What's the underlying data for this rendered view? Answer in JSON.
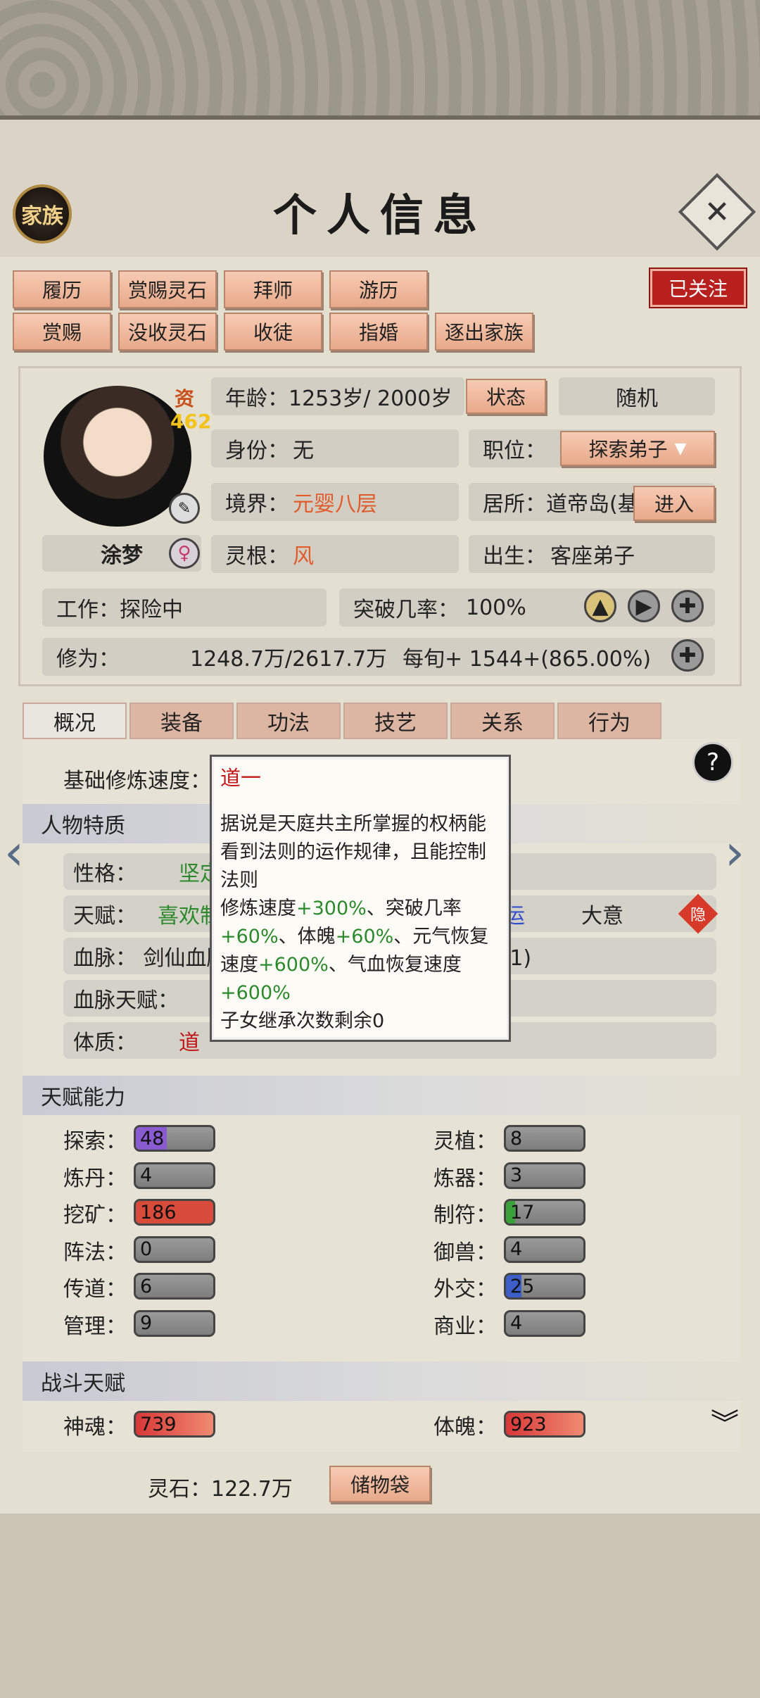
{
  "header": {
    "title": "个人信息",
    "family_label": "家族",
    "close_label": "✕"
  },
  "actions_row1": [
    "履历",
    "赏赐灵石",
    "拜师",
    "游历"
  ],
  "actions_row2": [
    "赏赐",
    "没收灵石",
    "收徒",
    "指婚",
    "逐出家族"
  ],
  "follow_label": "已关注",
  "portrait": {
    "zi_label": "资",
    "zi_value": "462",
    "name": "涂梦",
    "gender_icon": "female-icon"
  },
  "info": {
    "age": "年龄：1253岁/ 2000岁",
    "status_btn": "状态",
    "random_btn": "随机",
    "identity_label": "身份：",
    "identity_value": "无",
    "position_label": "职位：",
    "position_value": "探索弟子",
    "realm_label": "境界：",
    "realm_value": "元婴八层",
    "residence": "居所：道帝岛(基",
    "enter_btn": "进入",
    "root_label": "灵根：",
    "root_value": "风",
    "birth_label": "出生：",
    "birth_value": "客座弟子",
    "work": "工作：探险中",
    "breakthrough_label": "突破几率：",
    "breakthrough_value": "100%",
    "cultivation_label": "修为：",
    "cultivation_value": "1248.7万/2617.7万",
    "per_turn": "每旬+   1544+(865.00%)"
  },
  "tabs": [
    "概况",
    "装备",
    "功法",
    "技艺",
    "关系",
    "行为"
  ],
  "overview": {
    "base_speed_label": "基础修炼速度：",
    "help": "?",
    "traits_title": "人物特质",
    "personality_label": "性格：",
    "personality_value": "坚定",
    "talent_label": "天赋：",
    "talent_value": "喜欢制",
    "talent_value2": "运",
    "talent_value3": "大意",
    "hide_badge": "隐",
    "bloodline": "血脉：  剑仙血脉",
    "bloodline2": "脉(21)",
    "bloodline_talent_label": "血脉天赋：",
    "constitution_label": "体质：",
    "constitution_value": "道"
  },
  "tooltip": {
    "title": "道一",
    "desc": "据说是天庭共主所掌握的权柄能看到法则的运作规律，且能控制法则",
    "l1a": "修炼速度",
    "l1b": "+300%",
    "l1c": "、突破几率",
    "l2a": "+60%",
    "l2b": "、体魄",
    "l2c": "+60%",
    "l2d": "、元气恢复",
    "l3a": "速度",
    "l3b": "+600%",
    "l3c": "、气血恢复速度",
    "l4": "+600%",
    "l5": "子女继承次数剩余0"
  },
  "talent_ability": {
    "title": "天赋能力",
    "left": [
      {
        "label": "探索：",
        "value": "48",
        "color": "#8a5ad0",
        "fill": 0.4
      },
      {
        "label": "炼丹：",
        "value": "4",
        "color": "",
        "fill": 0
      },
      {
        "label": "挖矿：",
        "value": "186",
        "color": "#d84a3a",
        "fill": 1
      },
      {
        "label": "阵法：",
        "value": "0",
        "color": "",
        "fill": 0
      },
      {
        "label": "传道：",
        "value": "6",
        "color": "",
        "fill": 0
      },
      {
        "label": "管理：",
        "value": "9",
        "color": "",
        "fill": 0
      }
    ],
    "right": [
      {
        "label": "灵植：",
        "value": "8",
        "color": "",
        "fill": 0
      },
      {
        "label": "炼器：",
        "value": "3",
        "color": "",
        "fill": 0
      },
      {
        "label": "制符：",
        "value": "17",
        "color": "#3aa03a",
        "fill": 0.12
      },
      {
        "label": "御兽：",
        "value": "4",
        "color": "",
        "fill": 0
      },
      {
        "label": "外交：",
        "value": "25",
        "color": "#3d5ec8",
        "fill": 0.2
      },
      {
        "label": "商业：",
        "value": "4",
        "color": "",
        "fill": 0
      }
    ]
  },
  "combat": {
    "title": "战斗天赋",
    "soul_label": "神魂：",
    "soul_value": "739",
    "body_label": "体魄：",
    "body_value": "923"
  },
  "footer": {
    "spirit_stone": "灵石：122.7万",
    "bag_btn": "储物袋"
  }
}
